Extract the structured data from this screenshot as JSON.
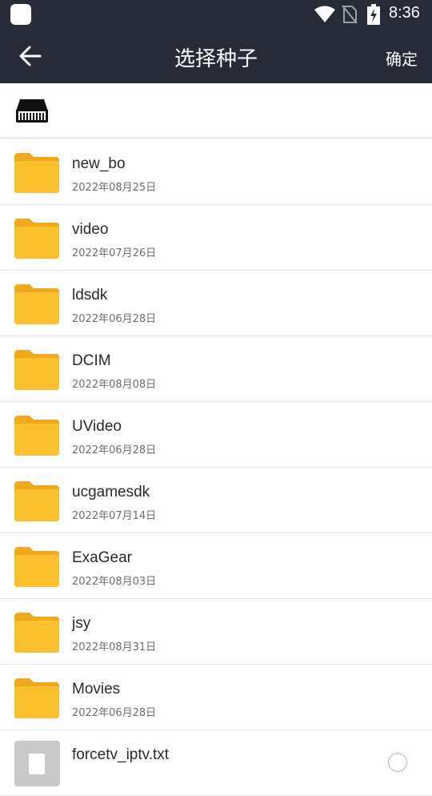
{
  "status_bar": {
    "time": "8:36",
    "icons": [
      "app-notification-icon",
      "wifi-icon",
      "no-sim-icon",
      "battery-charging-icon"
    ]
  },
  "app_bar": {
    "title": "选择种子",
    "confirm_label": "确定",
    "back_icon": "arrow-left-icon"
  },
  "path_bar": {
    "icon": "storage-drive-icon"
  },
  "colors": {
    "header_bg": "#262b37",
    "folder": "#fcc02e",
    "file_gray": "#c9c9c9"
  },
  "files": [
    {
      "name": "new_bo",
      "date": "2022年08月25日",
      "type": "folder"
    },
    {
      "name": "video",
      "date": "2022年07月26日",
      "type": "folder"
    },
    {
      "name": "ldsdk",
      "date": "2022年06月28日",
      "type": "folder"
    },
    {
      "name": "DCIM",
      "date": "2022年08月08日",
      "type": "folder"
    },
    {
      "name": "UVideo",
      "date": "2022年06月28日",
      "type": "folder"
    },
    {
      "name": "ucgamesdk",
      "date": "2022年07月14日",
      "type": "folder"
    },
    {
      "name": "ExaGear",
      "date": "2022年08月03日",
      "type": "folder"
    },
    {
      "name": "jsy",
      "date": "2022年08月31日",
      "type": "folder"
    },
    {
      "name": "Movies",
      "date": "2022年06月28日",
      "type": "folder"
    },
    {
      "name": "forcetv_iptv.txt",
      "date": "",
      "type": "file",
      "selectable": true
    }
  ]
}
